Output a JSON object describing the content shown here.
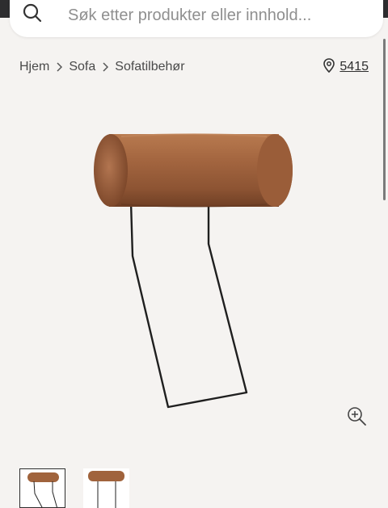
{
  "search": {
    "placeholder": "Søk etter produkter eller innhold..."
  },
  "breadcrumb": {
    "items": [
      "Hjem",
      "Sofa",
      "Sofatilbehør"
    ]
  },
  "store": {
    "number": "5415",
    "icon": "location-pin-icon"
  },
  "icons": {
    "search": "search-icon",
    "zoom": "zoom-in-icon",
    "chevron": "chevron-right-icon"
  },
  "colors": {
    "background": "#f5f3f1",
    "leather": "#a0633c",
    "frame": "#222222",
    "topbar": "#2d2d2f"
  },
  "thumbnails": [
    {
      "selected": true
    },
    {
      "selected": false
    }
  ]
}
